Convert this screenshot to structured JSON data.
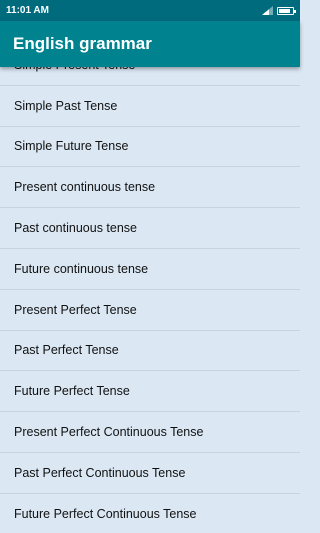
{
  "status_bar": {
    "time": "11:01 AM",
    "signal_icon": "signal-icon",
    "battery_icon": "battery-icon",
    "battery_level": 0.85
  },
  "app_bar": {
    "title": "English grammar"
  },
  "list": {
    "items": [
      {
        "label": "Simple Present Tense"
      },
      {
        "label": "Simple Past Tense"
      },
      {
        "label": "Simple Future Tense"
      },
      {
        "label": "Present continuous tense"
      },
      {
        "label": "Past continuous tense"
      },
      {
        "label": "Future continuous tense"
      },
      {
        "label": "Present Perfect Tense"
      },
      {
        "label": "Past Perfect Tense"
      },
      {
        "label": "Future Perfect Tense"
      },
      {
        "label": "Present Perfect Continuous Tense"
      },
      {
        "label": "Past Perfect Continuous Tense"
      },
      {
        "label": "Future Perfect Continuous Tense"
      }
    ]
  },
  "colors": {
    "status_bar": "#006b7d",
    "app_bar": "#00838f",
    "list_background": "#dbe8f4",
    "divider": "#c7d3de"
  }
}
